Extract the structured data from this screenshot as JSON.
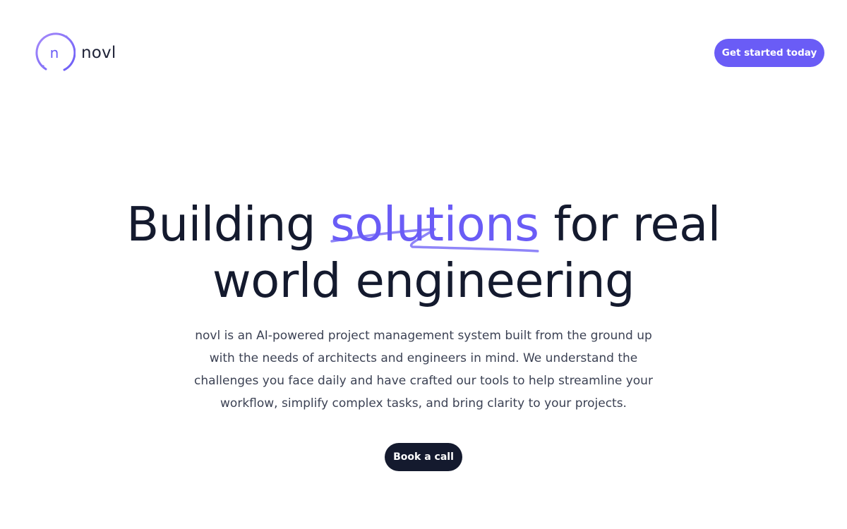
{
  "brand": {
    "name": "novl",
    "logo_icon": "novl-logo-icon",
    "logo_letter": "n",
    "accent_color": "#6a5cf6",
    "dark_color": "#141a2e"
  },
  "header": {
    "cta_label": "Get started today"
  },
  "hero": {
    "title_before": "Building",
    "title_accent": "solutions",
    "title_after": "for real",
    "title_line2": "world engineering",
    "description": "novl is an AI-powered project management system built from the ground up with the needs of architects and engineers in mind. We understand the challenges you face daily and have crafted our tools to help streamline your workflow, simplify complex tasks, and bring clarity to your projects.",
    "cta_label": "Book a call"
  }
}
